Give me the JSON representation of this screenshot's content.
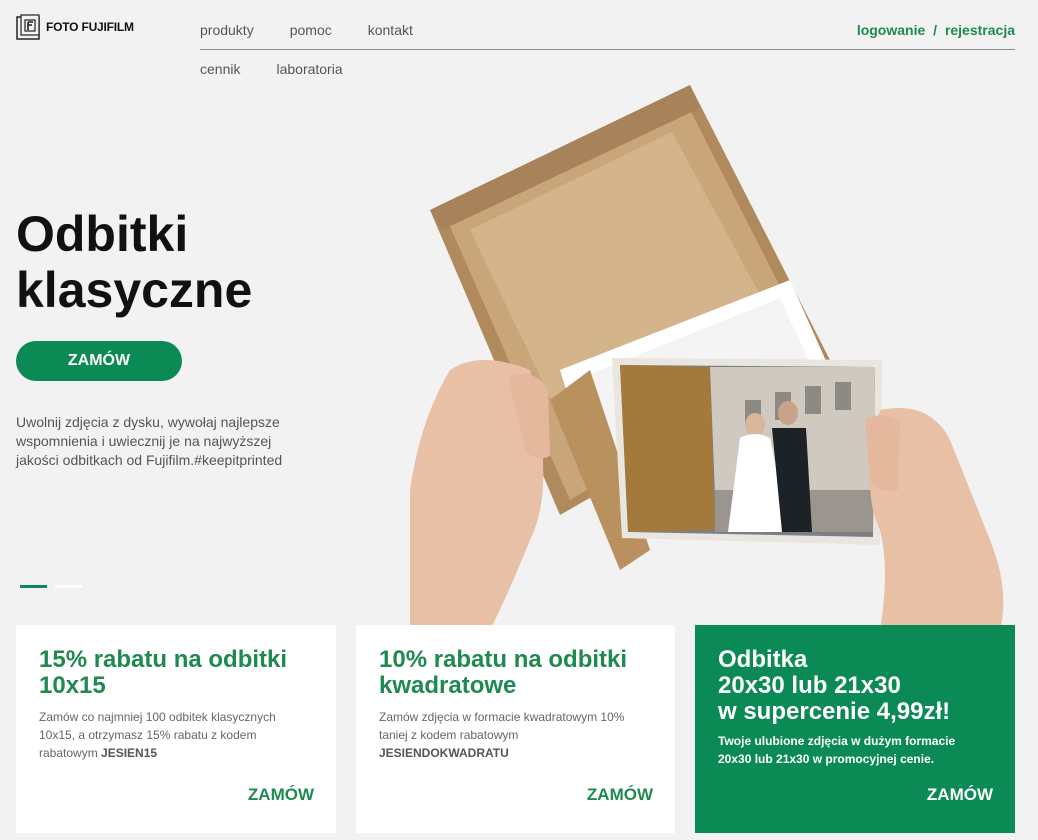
{
  "brand": {
    "logo_text": "FOTO FUJIFILM"
  },
  "nav": {
    "top": [
      "produkty",
      "pomoc",
      "kontakt"
    ],
    "bottom": [
      "cennik",
      "laboratoria"
    ]
  },
  "auth": {
    "login": "logowanie",
    "separator": "/",
    "register": "rejestracja"
  },
  "hero": {
    "title_line1": "Odbitki",
    "title_line2": "klasyczne",
    "button": "ZAMÓW",
    "description": "Uwolnij zdjęcia z dysku, wywołaj najlepsze wspomnienia i uwiecznij je na najwyższej jakości odbitkach od Fujifilm.#keepitprinted",
    "slides_total": 2,
    "slide_active": 1
  },
  "cards": [
    {
      "title": "15% rabatu na odbitki 10x15",
      "text": "Zamów co najmniej 100 odbitek klasycznych 10x15, a otrzymasz 15% rabatu z kodem rabatowym",
      "code": "JESIEN15",
      "link": "ZAMÓW"
    },
    {
      "title": "10% rabatu na odbitki kwadratowe",
      "text": "Zamów zdjęcia w formacie kwadratowym 10% taniej z kodem rabatowym",
      "code": "JESIENDOKWADRATU",
      "link": "ZAMÓW"
    },
    {
      "title_lines": [
        "Odbitka",
        "20x30 lub 21x30",
        "w supercenie 4,99zł!"
      ],
      "text": "Twoje ulubione zdjęcia w dużym formacie 20x30 lub 21x30 w promocyjnej cenie.",
      "link": "ZAMÓW"
    }
  ],
  "colors": {
    "accent": "#0b8a56",
    "accent_text": "#1f8a4f",
    "background": "#f2f2f2"
  }
}
